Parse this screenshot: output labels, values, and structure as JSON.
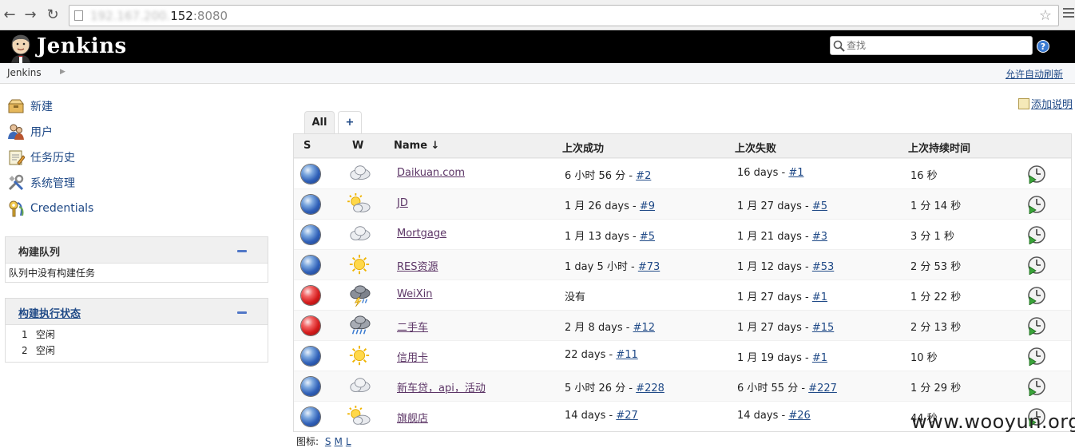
{
  "browser": {
    "url_host_hidden": "192.167.200.",
    "url_host_visible": "152",
    "url_port": ":8080"
  },
  "header": {
    "logo_text": "Jenkins",
    "search_placeholder": "查找",
    "help": "?"
  },
  "breadcrumb": {
    "root": "Jenkins",
    "autorefresh": "允许自动刷新"
  },
  "sidebar": {
    "tasks": [
      {
        "label": "新建",
        "icon": "new-item-icon"
      },
      {
        "label": "用户",
        "icon": "users-icon"
      },
      {
        "label": "任务历史",
        "icon": "build-history-icon"
      },
      {
        "label": "系统管理",
        "icon": "manage-icon"
      },
      {
        "label": "Credentials",
        "icon": "credentials-icon"
      }
    ],
    "queue": {
      "title": "构建队列",
      "empty_text": "队列中没有构建任务"
    },
    "executors": {
      "title": "构建执行状态",
      "rows": [
        {
          "num": "1",
          "status": "空闲"
        },
        {
          "num": "2",
          "status": "空闲"
        }
      ]
    }
  },
  "main": {
    "add_description": "添加说明",
    "tabs": {
      "all": "All",
      "add": "+"
    },
    "columns": {
      "s": "S",
      "w": "W",
      "name": "Name ↓",
      "last_success": "上次成功",
      "last_failure": "上次失败",
      "last_duration": "上次持续时间"
    },
    "jobs": [
      {
        "status": "blue",
        "weather": "cloudy",
        "name": "Daikuan.com",
        "success_text": "6 小时 56 分 - ",
        "success_build": "#2",
        "failure_text": "16 days - ",
        "failure_build": "#1",
        "duration": "16 秒"
      },
      {
        "status": "blue",
        "weather": "partly-sunny",
        "name": "JD",
        "success_text": "1 月 26 days - ",
        "success_build": "#9",
        "failure_text": "1 月 27 days - ",
        "failure_build": "#5",
        "duration": "1 分 14 秒"
      },
      {
        "status": "blue",
        "weather": "cloudy",
        "name": "Mortgage",
        "success_text": "1 月 13 days - ",
        "success_build": "#5",
        "failure_text": "1 月 21 days - ",
        "failure_build": "#3",
        "duration": "3 分 1 秒"
      },
      {
        "status": "blue",
        "weather": "sunny",
        "name": "RES资源",
        "success_text": "1 day 5 小时 - ",
        "success_build": "#73",
        "failure_text": "1 月 12 days - ",
        "failure_build": "#53",
        "duration": "2 分 53 秒"
      },
      {
        "status": "red",
        "weather": "thunderstorm",
        "name": "WeiXin",
        "success_text": "没有",
        "success_build": "",
        "failure_text": "1 月 27 days - ",
        "failure_build": "#1",
        "duration": "1 分 22 秒"
      },
      {
        "status": "red",
        "weather": "rain",
        "name": "二手车",
        "success_text": "2 月 8 days - ",
        "success_build": "#12",
        "failure_text": "1 月 27 days - ",
        "failure_build": "#15",
        "duration": "2 分 13 秒"
      },
      {
        "status": "blue",
        "weather": "sunny",
        "name": "信用卡",
        "success_text": "22 days - ",
        "success_build": "#11",
        "failure_text": "1 月 19 days - ",
        "failure_build": "#1",
        "duration": "10 秒"
      },
      {
        "status": "blue",
        "weather": "cloudy",
        "name": "新车贷，api，活动",
        "success_text": "5 小时 26 分 - ",
        "success_build": "#228",
        "failure_text": "6 小时 55 分 - ",
        "failure_build": "#227",
        "duration": "1 分 29 秒"
      },
      {
        "status": "blue",
        "weather": "partly-sunny",
        "name": "旗舰店",
        "success_text": "14 days - ",
        "success_build": "#27",
        "failure_text": "14 days - ",
        "failure_build": "#26",
        "duration": "44 秒"
      }
    ],
    "legend": {
      "label": "图标:",
      "s": "S",
      "m": "M",
      "l": "L"
    }
  },
  "watermark": "www.wooyun.org"
}
